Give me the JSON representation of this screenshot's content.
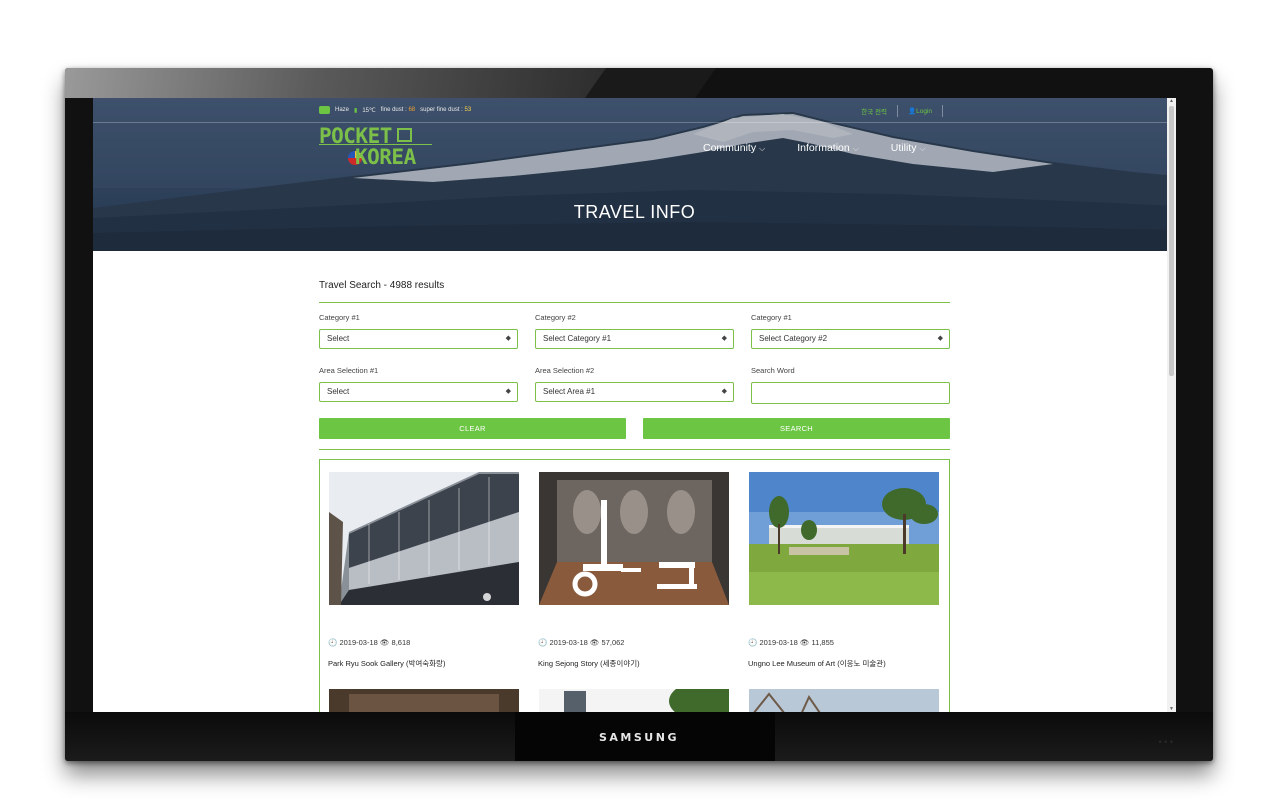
{
  "device": {
    "brand": "SAMSUNG"
  },
  "topbar": {
    "weather": "Haze",
    "temperature": "15℃",
    "fine_dust_label": "fine dust : ",
    "fine_dust_value": "68",
    "superfine_dust_label": "super fine dust : ",
    "superfine_dust_value": "53",
    "language_label": "한국 전력",
    "login_label": "Login"
  },
  "logo": {
    "line1": "POCKET",
    "line2": "KOREA"
  },
  "nav": {
    "items": [
      {
        "label": "Community"
      },
      {
        "label": "Information"
      },
      {
        "label": "Utility"
      }
    ]
  },
  "hero": {
    "title": "TRAVEL INFO"
  },
  "search": {
    "title": "Travel Search - 4988 results",
    "category1_label": "Category #1",
    "category1_value": "Select",
    "category2_label": "Category #2",
    "category2_value": "Select Category #1",
    "category3_label": "Category #1",
    "category3_value": "Select Category #2",
    "area1_label": "Area Selection #1",
    "area1_value": "Select",
    "area2_label": "Area Selection #2",
    "area2_value": "Select Area #1",
    "word_label": "Search Word",
    "word_value": "",
    "clear_label": "CLEAR",
    "search_label": "SEARCH"
  },
  "results": [
    {
      "date": "2019-03-18",
      "views": "8,618",
      "name": "Park Ryu Sook Gallery (박여숙화랑)"
    },
    {
      "date": "2019-03-18",
      "views": "57,062",
      "name": "King Sejong Story (세종이야기)"
    },
    {
      "date": "2019-03-18",
      "views": "11,855",
      "name": "Ungno Lee Museum of Art (이응노 미술관)"
    }
  ],
  "colors": {
    "accent": "#6cc644",
    "hero_overlay": "#39506c"
  }
}
